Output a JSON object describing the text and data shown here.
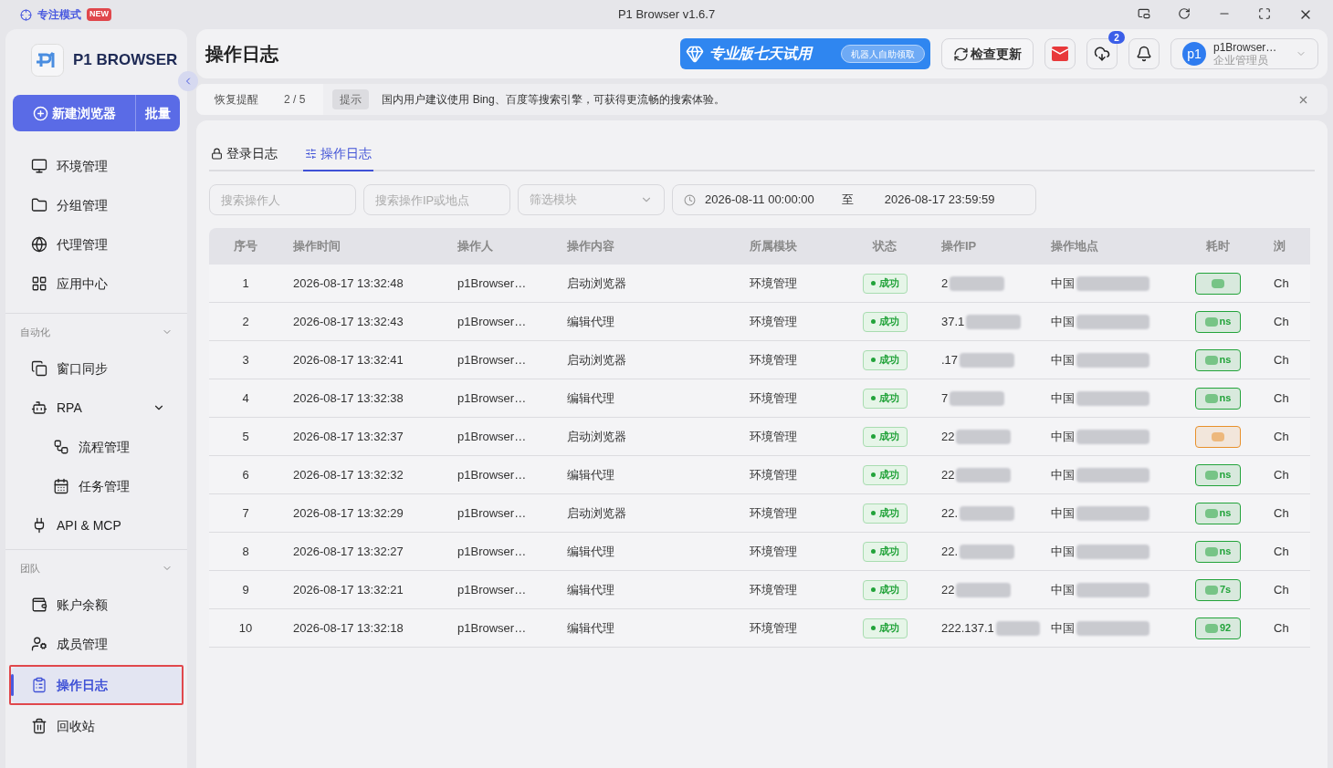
{
  "title_bar": {
    "focus_mode": "专注模式",
    "badge": "NEW",
    "title": "P1 Browser v1.6.7"
  },
  "sidebar": {
    "logo": "P1 BROWSER",
    "new_button": "新建浏览器",
    "batch_button": "批量",
    "items": [
      {
        "label": "环境管理",
        "selected": false
      },
      {
        "label": "分组管理",
        "selected": false
      },
      {
        "label": "代理管理",
        "selected": false
      },
      {
        "label": "应用中心",
        "selected": false
      }
    ],
    "sections": [
      {
        "label": "自动化",
        "expanded": true,
        "items": [
          {
            "label": "窗口同步",
            "selected": false
          },
          {
            "label": "RPA",
            "selected": false,
            "expanded": true,
            "children": [
              {
                "label": "流程管理",
                "selected": false
              },
              {
                "label": "任务管理",
                "selected": false
              }
            ]
          },
          {
            "label": "API & MCP",
            "selected": false
          }
        ]
      },
      {
        "label": "团队",
        "expanded": true,
        "items": [
          {
            "label": "账户余额",
            "selected": false
          },
          {
            "label": "成员管理",
            "selected": false
          },
          {
            "label": "操作日志",
            "selected": true,
            "highlighted": true
          },
          {
            "label": "回收站",
            "selected": false
          }
        ]
      }
    ]
  },
  "header": {
    "title": "操作日志",
    "promo": "专业版七天试用",
    "promo_button": "机器人自助领取",
    "update_button": "检查更新",
    "download_badge": "2",
    "user": {
      "avatar": "p1",
      "name": "p1Browser…",
      "role": "企业管理员"
    }
  },
  "notice": {
    "label": "恢复提醒",
    "counter": "2 / 5",
    "tag": "提示",
    "text": "国内用户建议使用 Bing、百度等搜索引擎，可获得更流畅的搜索体验。"
  },
  "tabs": [
    {
      "label": "登录日志",
      "selected": false
    },
    {
      "label": "操作日志",
      "selected": true
    }
  ],
  "filters": {
    "operator_placeholder": "搜索操作人",
    "ip_placeholder": "搜索操作IP或地点",
    "module_placeholder": "筛选模块",
    "date_start": "2026-08-11 00:00:00",
    "date_sep": "至",
    "date_end": "2026-08-17 23:59:59"
  },
  "table": {
    "columns": [
      "序号",
      "操作时间",
      "操作人",
      "操作内容",
      "所属模块",
      "状态",
      "操作IP",
      "操作地点",
      "耗时",
      "浏"
    ],
    "rows": [
      {
        "no": "1",
        "time": "2026-08-17 13:32:48",
        "operator": "p1Browser…",
        "content": "启动浏览器",
        "module": "环境管理",
        "status": "成功",
        "ip": "2",
        "location": "中国",
        "duration": {
          "color": "#22a33a"
        },
        "browser": "Ch"
      },
      {
        "no": "2",
        "time": "2026-08-17 13:32:43",
        "operator": "p1Browser…",
        "content": "编辑代理",
        "module": "环境管理",
        "status": "成功",
        "ip": "37.1",
        "location": "中国",
        "duration": {
          "text": "ns",
          "color": "#22a33a"
        },
        "browser": "Ch"
      },
      {
        "no": "3",
        "time": "2026-08-17 13:32:41",
        "operator": "p1Browser…",
        "content": "启动浏览器",
        "module": "环境管理",
        "status": "成功",
        "ip": ".17",
        "location": "中国",
        "duration": {
          "text": "ns",
          "color": "#22a33a"
        },
        "browser": "Ch"
      },
      {
        "no": "4",
        "time": "2026-08-17 13:32:38",
        "operator": "p1Browser…",
        "content": "编辑代理",
        "module": "环境管理",
        "status": "成功",
        "ip": "7",
        "location": "中国",
        "duration": {
          "text": "ns",
          "color": "#22a33a"
        },
        "browser": "Ch"
      },
      {
        "no": "5",
        "time": "2026-08-17 13:32:37",
        "operator": "p1Browser…",
        "content": "启动浏览器",
        "module": "环境管理",
        "status": "成功",
        "ip": "22",
        "location": "中国",
        "duration": {
          "color": "#e8902a"
        },
        "browser": "Ch"
      },
      {
        "no": "6",
        "time": "2026-08-17 13:32:32",
        "operator": "p1Browser…",
        "content": "编辑代理",
        "module": "环境管理",
        "status": "成功",
        "ip": "22",
        "location": "中国",
        "duration": {
          "text": "ns",
          "color": "#22a33a"
        },
        "browser": "Ch"
      },
      {
        "no": "7",
        "time": "2026-08-17 13:32:29",
        "operator": "p1Browser…",
        "content": "启动浏览器",
        "module": "环境管理",
        "status": "成功",
        "ip": "22.",
        "location": "中国",
        "duration": {
          "text": "ns",
          "color": "#22a33a"
        },
        "browser": "Ch"
      },
      {
        "no": "8",
        "time": "2026-08-17 13:32:27",
        "operator": "p1Browser…",
        "content": "编辑代理",
        "module": "环境管理",
        "status": "成功",
        "ip": "22.",
        "location": "中国",
        "duration": {
          "text": "ns",
          "color": "#22a33a"
        },
        "browser": "Ch"
      },
      {
        "no": "9",
        "time": "2026-08-17 13:32:21",
        "operator": "p1Browser…",
        "content": "编辑代理",
        "module": "环境管理",
        "status": "成功",
        "ip": "22",
        "location": "中国",
        "duration": {
          "text": "7s",
          "color": "#22a33a"
        },
        "browser": "Ch"
      },
      {
        "no": "10",
        "time": "2026-08-17 13:32:18",
        "operator": "p1Browser…",
        "content": "编辑代理",
        "module": "环境管理",
        "status": "成功",
        "ip": "222.137.1",
        "location": "中国",
        "duration": {
          "text": "92",
          "color": "#22a33a"
        },
        "browser": "Ch"
      }
    ]
  }
}
